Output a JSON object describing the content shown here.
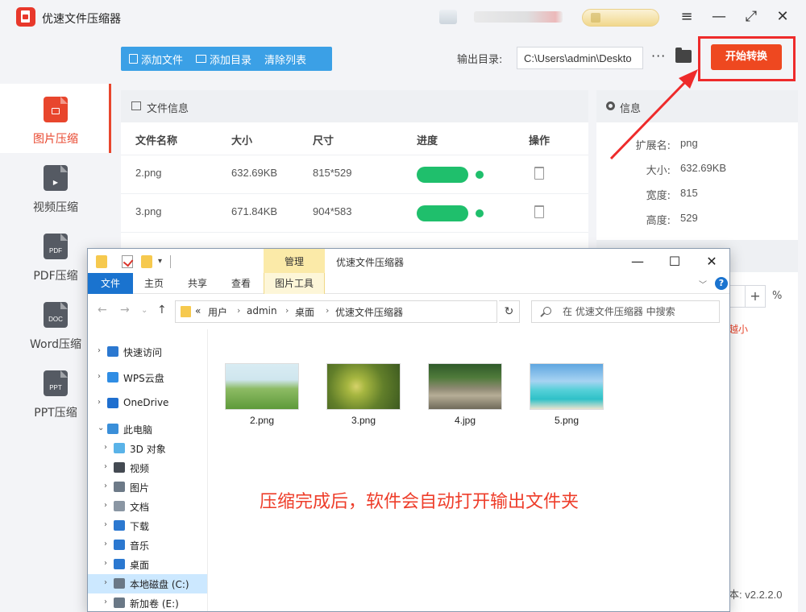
{
  "app": {
    "title": "优速文件压缩器",
    "window_controls": [
      "≡",
      "—",
      "⤢",
      "✕"
    ]
  },
  "nav": [
    {
      "label": "图片压缩",
      "icon": "image-file-icon",
      "tag": "",
      "color": "#e8462d",
      "active": true
    },
    {
      "label": "视频压缩",
      "icon": "video-file-icon",
      "tag": "▶",
      "color": "#555a63",
      "active": false
    },
    {
      "label": "PDF压缩",
      "icon": "pdf-file-icon",
      "tag": "PDF",
      "color": "#555a63",
      "active": false
    },
    {
      "label": "Word压缩",
      "icon": "doc-file-icon",
      "tag": "DOC",
      "color": "#555a63",
      "active": false
    },
    {
      "label": "PPT压缩",
      "icon": "ppt-file-icon",
      "tag": "PPT",
      "color": "#555a63",
      "active": false
    }
  ],
  "toolbar": {
    "add_file": "添加文件",
    "add_folder": "添加目录",
    "clear_list": "清除列表",
    "output_label": "输出目录:",
    "output_path": "C:\\Users\\admin\\Deskto",
    "more": "···",
    "start": "开始转换"
  },
  "file_panel": {
    "title": "文件信息",
    "columns": [
      "文件名称",
      "大小",
      "尺寸",
      "进度",
      "操作"
    ],
    "rows": [
      {
        "name": "2.png",
        "size": "632.69KB",
        "dims": "815*529",
        "progress": 1.0
      },
      {
        "name": "3.png",
        "size": "671.84KB",
        "dims": "904*583",
        "progress": 1.0
      }
    ]
  },
  "info_panel": {
    "title": "信息",
    "rows": [
      {
        "key": "扩展名:",
        "value": "png"
      },
      {
        "key": "大小:",
        "value": "632.69KB"
      },
      {
        "key": "宽度:",
        "value": "815"
      },
      {
        "key": "高度:",
        "value": "529"
      }
    ]
  },
  "settings": {
    "plus": "+",
    "percent": "%",
    "hint_partial": "越小",
    "version": "本: v2.2.2.0"
  },
  "explorer": {
    "manage_tab": "管理",
    "window_title": "优速文件压缩器",
    "ribbon_tabs": [
      "文件",
      "主页",
      "共享",
      "查看",
      "图片工具"
    ],
    "address": {
      "prefix": "«",
      "crumbs": [
        "用户",
        "admin",
        "桌面",
        "优速文件压缩器"
      ]
    },
    "search_placeholder": "在 优速文件压缩器 中搜索",
    "tree": [
      {
        "label": "快速访问",
        "icon": "star-icon",
        "color": "#2b78d0",
        "indent": 0,
        "selected": false
      },
      {
        "label": "WPS云盘",
        "icon": "cloud-icon",
        "color": "#2f8de4",
        "indent": 0,
        "selected": false
      },
      {
        "label": "OneDrive",
        "icon": "onedrive-icon",
        "color": "#1f6fcf",
        "indent": 0,
        "selected": false
      },
      {
        "label": "此电脑",
        "icon": "computer-icon",
        "color": "#3a8fd9",
        "indent": 0,
        "selected": false,
        "expanded": true
      },
      {
        "label": "3D 对象",
        "icon": "3d-objects-icon",
        "color": "#5ab3e8",
        "indent": 1,
        "selected": false
      },
      {
        "label": "视频",
        "icon": "video-folder-icon",
        "color": "#444a52",
        "indent": 1,
        "selected": false
      },
      {
        "label": "图片",
        "icon": "pictures-folder-icon",
        "color": "#6d7a88",
        "indent": 1,
        "selected": false
      },
      {
        "label": "文档",
        "icon": "documents-folder-icon",
        "color": "#8a96a3",
        "indent": 1,
        "selected": false
      },
      {
        "label": "下载",
        "icon": "download-icon",
        "color": "#2b78d0",
        "indent": 1,
        "selected": false
      },
      {
        "label": "音乐",
        "icon": "music-icon",
        "color": "#2b78d0",
        "indent": 1,
        "selected": false
      },
      {
        "label": "桌面",
        "icon": "desktop-icon",
        "color": "#2b78d0",
        "indent": 1,
        "selected": false
      },
      {
        "label": "本地磁盘 (C:)",
        "icon": "drive-c-icon",
        "color": "#6a7886",
        "indent": 1,
        "selected": true
      },
      {
        "label": "新加卷 (E:)",
        "icon": "drive-e-icon",
        "color": "#6a7886",
        "indent": 1,
        "selected": false
      }
    ],
    "files": [
      {
        "name": "2.png",
        "icon": "landscape-thumbnail"
      },
      {
        "name": "3.png",
        "icon": "flowers-thumbnail"
      },
      {
        "name": "4.jpg",
        "icon": "river-thumbnail"
      },
      {
        "name": "5.png",
        "icon": "beach-thumbnail"
      }
    ],
    "note": "压缩完成后，软件会自动打开输出文件夹"
  },
  "colors": {
    "accent": "#e8462d",
    "start_button": "#ee4820",
    "toolbar_blue": "#3ba0e6",
    "progress_green": "#1fbf6c",
    "annotation_red": "#ee2b2b"
  }
}
